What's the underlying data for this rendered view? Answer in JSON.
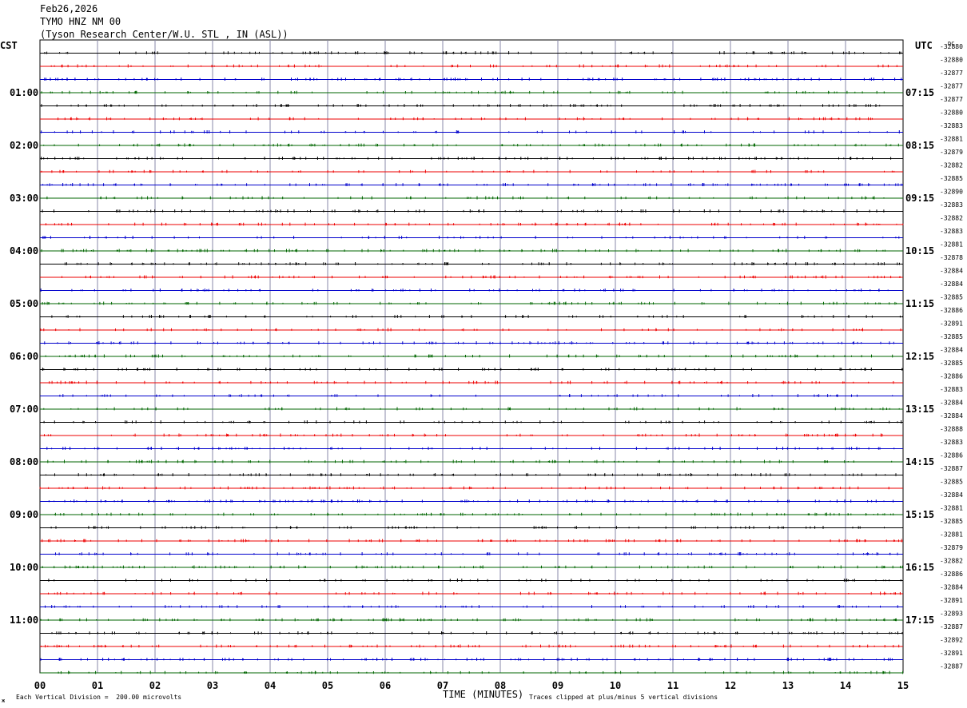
{
  "header": {
    "date": "Feb26,2026",
    "station": "TYMO HNZ NM 00",
    "location": "(Tyson Research Center/W.U. STL , IN (ASL))"
  },
  "left_timezone": "CST",
  "right_timezone": "UTC",
  "dc_label": "DC",
  "footer": {
    "scale_note": "Each Vertical Division =  200.00 microvolts",
    "xlabel": "TIME (MINUTES)",
    "clip_note": "Traces clipped at plus/minus 5 vertical divisions",
    "corner_mark": "ж"
  },
  "chart_data": {
    "type": "line",
    "title": "TYMO HNZ NM 00",
    "xlabel": "TIME (MINUTES)",
    "xlim": [
      0,
      15
    ],
    "x_ticks": [
      "00",
      "01",
      "02",
      "03",
      "04",
      "05",
      "06",
      "07",
      "08",
      "09",
      "10",
      "11",
      "12",
      "13",
      "14",
      "15"
    ],
    "left_hour_labels": [
      "01:00",
      "02:00",
      "03:00",
      "04:00",
      "05:00",
      "06:00",
      "07:00",
      "08:00",
      "09:00",
      "10:00",
      "11:00"
    ],
    "right_hour_labels": [
      "07:15",
      "08:15",
      "09:15",
      "10:15",
      "11:15",
      "12:15",
      "13:15",
      "14:15",
      "15:15",
      "16:15",
      "17:15"
    ],
    "dc_offsets": [
      "-32880",
      "-32880",
      "-32877",
      "-32877",
      "-32877",
      "-32880",
      "-32883",
      "-32881",
      "-32879",
      "-32882",
      "-32885",
      "-32890",
      "-32883",
      "-32882",
      "-32883",
      "-32881",
      "-32878",
      "-32884",
      "-32884",
      "-32885",
      "-32886",
      "-32891",
      "-32885",
      "-32884",
      "-32885",
      "-32886",
      "-32883",
      "-32884",
      "-32884",
      "-32888",
      "-32883",
      "-32886",
      "-32887",
      "-32885",
      "-32884",
      "-32881",
      "-32885",
      "-32881",
      "-32879",
      "-32882",
      "-32886",
      "-32884",
      "-32891",
      "-32893",
      "-32887",
      "-32892",
      "-32891",
      "-32887"
    ],
    "trace_colors": [
      "#000000",
      "#ee0000",
      "#0000cc",
      "#006600"
    ],
    "grid_color": "#8888aa",
    "trace_count": 48,
    "minutes_per_trace": 15
  }
}
